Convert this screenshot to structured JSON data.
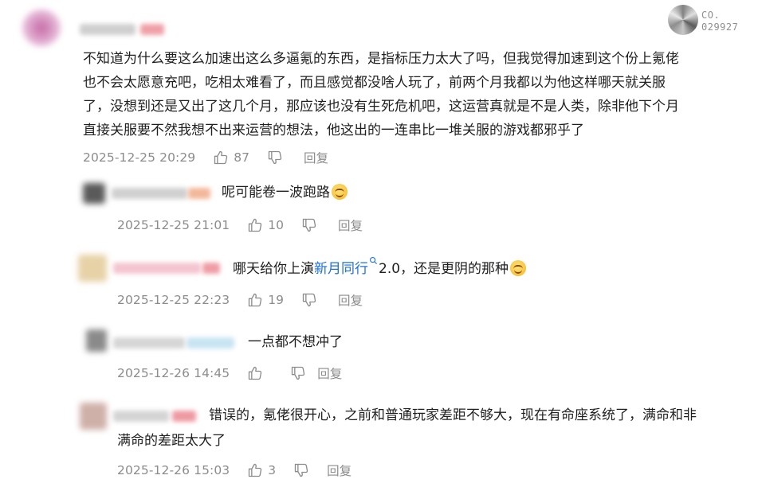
{
  "watermark": {
    "line1": "CO.",
    "line2": "029927"
  },
  "comments": [
    {
      "lines": [
        "不知道为什么要这么加速出这么多逼氪的东西，是指标压力太大了吗，但我觉得加速到这个份上氪佬",
        "也不会太愿意充吧，吃相太难看了，而且感觉都没啥人玩了，前两个月我都以为他这样哪天就关服",
        "了，没想到还是又出了这几个月，那应该也没有生死危机吧，这运营真就是不是人类，除非他下个月",
        "直接关服要不然我想不出来运营的想法，他这出的一连串比一堆关服的游戏都邪乎了"
      ],
      "time": "2025-12-25 20:29",
      "likes": "87",
      "reply": "回复"
    },
    {
      "text": "呢可能卷一波跑路",
      "time": "2025-12-25 21:01",
      "likes": "10",
      "reply": "回复"
    },
    {
      "text_before": "哪天给你上演",
      "link": "新月同行",
      "text_after": "2.0，还是更阴的那种",
      "time": "2025-12-25 22:23",
      "likes": "19",
      "reply": "回复"
    },
    {
      "text": "一点都不想冲了",
      "time": "2025-12-26 14:45",
      "likes": "",
      "reply": "回复"
    },
    {
      "line1": "错误的，氪佬很开心，之前和普通玩家差距不够大，现在有命座系统了，满命和非",
      "line2": "满命的差距太大了",
      "time": "2025-12-26 15:03",
      "likes": "3",
      "reply": "回复"
    }
  ]
}
